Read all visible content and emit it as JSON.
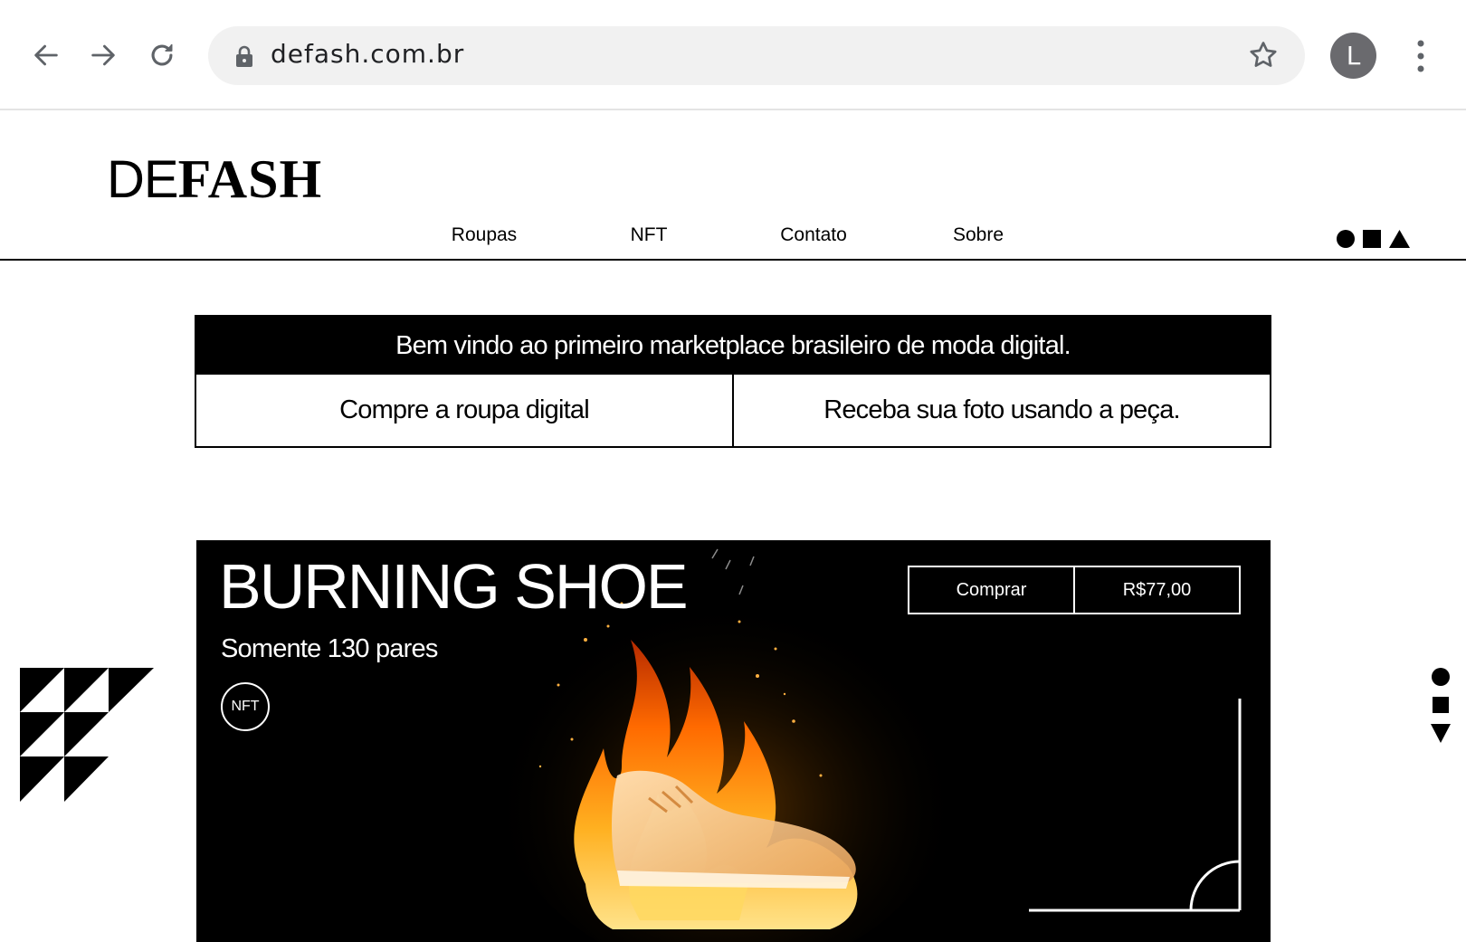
{
  "browser": {
    "url": "defash.com.br",
    "profile_initial": "L",
    "icons": [
      "back-arrow-icon",
      "forward-arrow-icon",
      "reload-icon",
      "lock-icon",
      "star-icon",
      "more-vert-icon"
    ]
  },
  "site": {
    "logo_thin": "DE",
    "logo_bold": "FASH",
    "nav": [
      "Roupas",
      "NFT",
      "Contato",
      "Sobre"
    ],
    "nav_shape_icons": [
      "circle-icon",
      "square-icon",
      "triangle-up-icon"
    ]
  },
  "intro": {
    "headline": "Bem vindo ao primeiro marketplace brasileiro de moda digital.",
    "steps": [
      "Compre a roupa digital",
      "Receba sua foto usando a peça."
    ]
  },
  "hero": {
    "title": "BURNING SHOE",
    "subtitle": "Somente 130 pares",
    "badge": "NFT",
    "buy_label": "Comprar",
    "price": "R$77,00",
    "image": "burning-sneaker-image"
  },
  "decor": {
    "left": "triangle-pattern-logo",
    "right_icons": [
      "circle-icon",
      "square-icon",
      "triangle-down-icon"
    ]
  },
  "colors": {
    "background": "#ffffff",
    "text": "#000000",
    "hero_bg": "#000000",
    "omnibox_bg": "#f1f1f1",
    "avatar_bg": "#6a6a6e",
    "flame_orange": "#ff7a00",
    "flame_yellow": "#ffd84a"
  }
}
